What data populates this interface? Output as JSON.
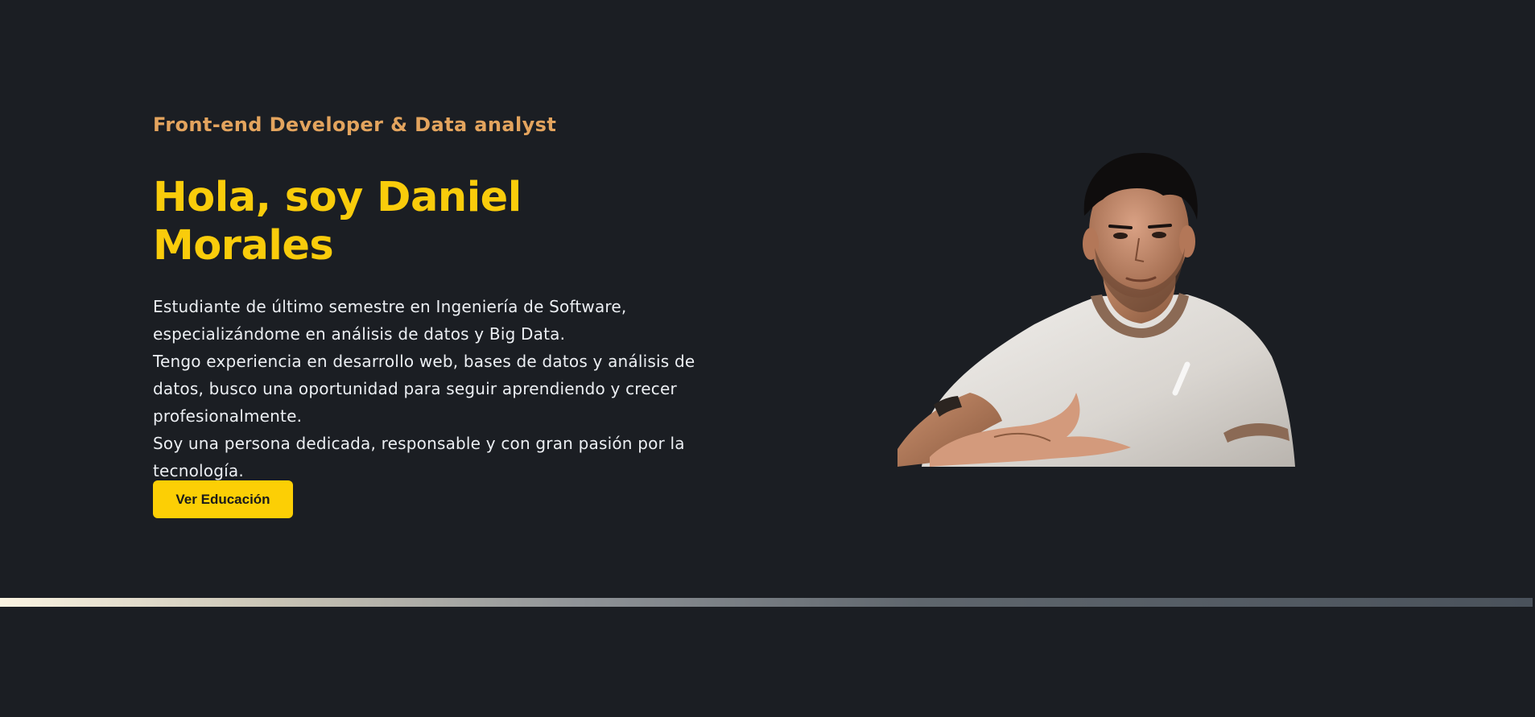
{
  "hero": {
    "role": "Front-end Developer & Data analyst",
    "headline": "Hola, soy Daniel Morales",
    "bio": [
      "Estudiante de último semestre en Ingeniería de Software, especializándome en análisis de datos y Big Data.",
      "Tengo experiencia en desarrollo web, bases de datos y análisis de datos, busco una oportunidad para seguir aprendiendo y crecer profesionalmente.",
      "Soy una persona dedicada, responsable y con gran pasión por la tecnología."
    ],
    "cta_label": "Ver Educación"
  },
  "colors": {
    "background": "#1b1e23",
    "accent_yellow": "#f9cc0b",
    "accent_orange": "#e3a45e",
    "text": "#eceff3"
  }
}
